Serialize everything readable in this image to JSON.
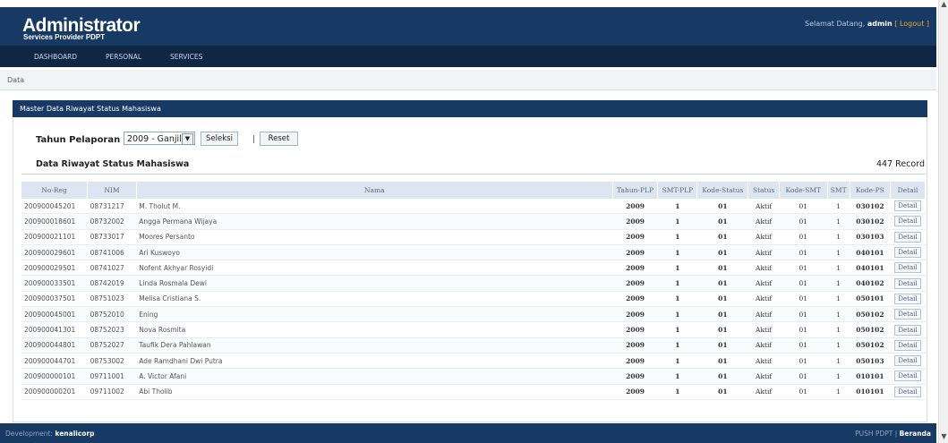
{
  "header": {
    "title": "Administrator",
    "subtitle": "Services Provider PDPT",
    "welcome_prefix": "Selamat Datang,",
    "user": "admin",
    "logout": "[ Logout ]"
  },
  "nav": {
    "items": [
      "DASHBOARD",
      "PERSONAL",
      "SERVICES"
    ]
  },
  "breadcrumb": "Data",
  "panel": {
    "title": "Master Data Riwayat Status Mahasiswa"
  },
  "filter": {
    "label": "Tahun Pelaporan",
    "selected": "2009 - Ganjil",
    "select_button": "Seleksi",
    "separator": "|",
    "reset_button": "Reset"
  },
  "table": {
    "title": "Data Riwayat Status Mahasiswa",
    "record_count": "447 Record",
    "columns": [
      "No-Reg",
      "NIM",
      "Nama",
      "Tahun-PLP",
      "SMT-PLP",
      "Kode-Status",
      "Status",
      "Kode-SMT",
      "SMT",
      "Kode-PS",
      "Detail"
    ],
    "rows": [
      [
        "200900045201",
        "08731217",
        "M. Tholut M.",
        "2009",
        "1",
        "01",
        "Aktif",
        "01",
        "1",
        "030102",
        "Detail"
      ],
      [
        "200900018601",
        "08732002",
        "Angga Permana Wijaya",
        "2009",
        "1",
        "01",
        "Aktif",
        "01",
        "1",
        "030102",
        "Detail"
      ],
      [
        "200900021101",
        "08733017",
        "Moores Persanto",
        "2009",
        "1",
        "01",
        "Aktif",
        "01",
        "1",
        "030103",
        "Detail"
      ],
      [
        "200900029601",
        "08741006",
        "Ari Kuswoyo",
        "2009",
        "1",
        "01",
        "Aktif",
        "01",
        "1",
        "040101",
        "Detail"
      ],
      [
        "200900029501",
        "08741027",
        "Nofent Akhyar Rosyidi",
        "2009",
        "1",
        "01",
        "Aktif",
        "01",
        "1",
        "040101",
        "Detail"
      ],
      [
        "200900033501",
        "08742019",
        "Linda Rosmala Dewi",
        "2009",
        "1",
        "01",
        "Aktif",
        "01",
        "1",
        "040102",
        "Detail"
      ],
      [
        "200900037501",
        "08751023",
        "Melisa Cristiana S.",
        "2009",
        "1",
        "01",
        "Aktif",
        "01",
        "1",
        "050101",
        "Detail"
      ],
      [
        "200900045001",
        "08752010",
        "Ening",
        "2009",
        "1",
        "01",
        "Aktif",
        "01",
        "1",
        "050102",
        "Detail"
      ],
      [
        "200900041301",
        "08752023",
        "Nova Rosmita",
        "2009",
        "1",
        "01",
        "Aktif",
        "01",
        "1",
        "050102",
        "Detail"
      ],
      [
        "200900044801",
        "08752027",
        "Taufik Dera Pahlawan",
        "2009",
        "1",
        "01",
        "Aktif",
        "01",
        "1",
        "050102",
        "Detail"
      ],
      [
        "200900044701",
        "08753002",
        "Ade Ramdhani Dwi Putra",
        "2009",
        "1",
        "01",
        "Aktif",
        "01",
        "1",
        "050103",
        "Detail"
      ],
      [
        "200900000101",
        "09711001",
        "A. Victor Afani",
        "2009",
        "1",
        "01",
        "Aktif",
        "01",
        "1",
        "010101",
        "Detail"
      ],
      [
        "200900000201",
        "09711002",
        "Abi Tholib",
        "2009",
        "1",
        "01",
        "Aktif",
        "01",
        "1",
        "010101",
        "Detail"
      ]
    ]
  },
  "footer": {
    "left_prefix": "Development:",
    "left_name": "kenalicorp",
    "right_prefix": "PUSH PDPT |",
    "right_link": "Beranda"
  },
  "colors": {
    "header_bg": "#163a63",
    "nav_bg": "#0f2744",
    "table_header_bg": "#dce5f0",
    "logout": "#f3a02a"
  }
}
